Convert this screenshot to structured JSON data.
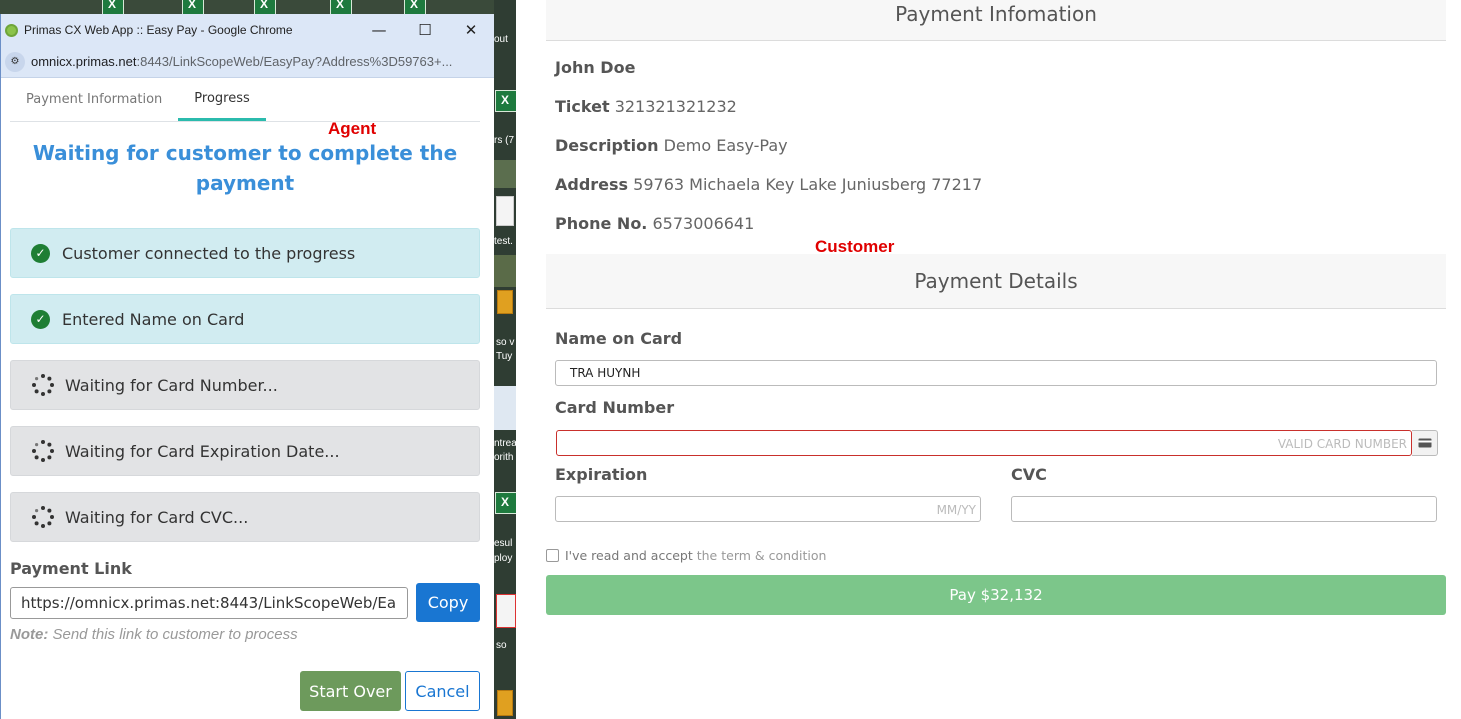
{
  "browser": {
    "window_title": "Primas CX Web App :: Easy Pay - Google Chrome",
    "url_host": "omnicx.primas.net",
    "url_rest": ":8443/LinkScopeWeb/EasyPay?Address%3D59763+...",
    "minimize": "—",
    "maximize": "☐",
    "close": "✕"
  },
  "agent": {
    "tabs": [
      {
        "label": "Payment Information"
      },
      {
        "label": "Progress"
      }
    ],
    "overlay_label": "Agent",
    "heading": "Waiting for customer to complete the payment",
    "steps": [
      {
        "label": "Customer connected to the progress",
        "status": "done"
      },
      {
        "label": "Entered Name on Card",
        "status": "done"
      },
      {
        "label": "Waiting for Card Number...",
        "status": "waiting"
      },
      {
        "label": "Waiting for Card Expiration Date...",
        "status": "waiting"
      },
      {
        "label": "Waiting for Card CVC...",
        "status": "waiting"
      }
    ],
    "payment_link_label": "Payment Link",
    "payment_link_value": "https://omnicx.primas.net:8443/LinkScopeWeb/Ea",
    "copy_label": "Copy",
    "note_prefix": "Note:",
    "note_text": " Send this link to customer to process",
    "start_over_label": "Start Over",
    "cancel_label": "Cancel"
  },
  "customer": {
    "overlay_label": "Customer",
    "info_header": "Payment Infomation",
    "name": "John Doe",
    "ticket_label": "Ticket",
    "ticket_value": "321321321232",
    "description_label": "Description",
    "description_value": "Demo Easy-Pay",
    "address_label": "Address",
    "address_value": "59763 Michaela Key Lake Juniusberg 77217",
    "phone_label": "Phone No.",
    "phone_value": "6573006641",
    "details_header": "Payment Details",
    "name_on_card_label": "Name on Card",
    "name_on_card_value": "TRA HUYNH",
    "card_number_label": "Card Number",
    "card_number_placeholder": "VALID CARD NUMBER",
    "expiration_label": "Expiration",
    "expiration_placeholder": "MM/YY",
    "cvc_label": "CVC",
    "terms_text": "I've read and accept",
    "terms_link": "the term & condition",
    "pay_label": "Pay $32,132"
  },
  "desktop": {
    "snippets": [
      "out",
      "rs (7",
      "test.",
      "so v",
      "Tuy",
      "ntrea",
      "orith",
      "esul",
      "ploy",
      "so"
    ]
  },
  "colors": {
    "heading_blue": "#3a8fd9",
    "primary_blue": "#1976d2",
    "start_over_green": "#6d9a5c",
    "pay_green": "#7cc68a",
    "done_bg": "#d1ecf1",
    "waiting_bg": "#e2e3e5",
    "overlay_red": "#e00000",
    "error_border": "#c9302c"
  }
}
